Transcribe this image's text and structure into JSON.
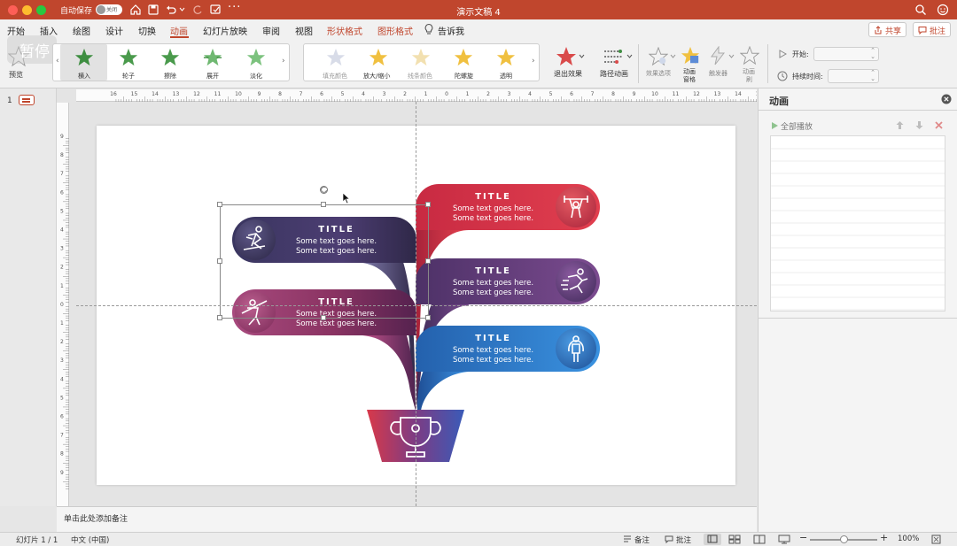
{
  "titlebar": {
    "autosave_label": "自动保存",
    "autosave_toggle": "关闭",
    "doc_title": "演示文稿 4"
  },
  "menu": {
    "items": [
      "开始",
      "插入",
      "绘图",
      "设计",
      "切换",
      "动画",
      "幻灯片放映",
      "审阅",
      "视图",
      "形状格式",
      "图形格式"
    ],
    "tell_me": "告诉我",
    "share": "共享",
    "comments": "批注",
    "active_index": 5
  },
  "ribbon": {
    "preview": "预览",
    "entrance_effects": [
      "横入",
      "轮子",
      "擦除",
      "展开",
      "淡化"
    ],
    "emphasis_effects": [
      "填充颜色",
      "放大/缩小",
      "线条颜色",
      "陀螺旋",
      "透明"
    ],
    "exit_effects": "退出效果",
    "path_animation": "路径动画",
    "effect_options": "效果选项",
    "anim_pane_1": "动画",
    "anim_pane_2": "窗格",
    "trigger": "触发器",
    "anim_painter_1": "动画",
    "anim_painter_2": "刷",
    "start_label": "开始:",
    "duration_label": "持续时间:",
    "pause_watermark": "暂停"
  },
  "thumb": {
    "slide_number": "1"
  },
  "ruler_h": [
    "16",
    "15",
    "14",
    "13",
    "12",
    "11",
    "10",
    "9",
    "8",
    "7",
    "6",
    "5",
    "4",
    "3",
    "2",
    "1",
    "0",
    "1",
    "2",
    "3",
    "4",
    "5",
    "6",
    "7",
    "8",
    "9",
    "10",
    "11",
    "12",
    "13",
    "14",
    "15",
    "16"
  ],
  "ruler_v": [
    "9",
    "8",
    "7",
    "6",
    "5",
    "4",
    "3",
    "2",
    "1",
    "0",
    "1",
    "2",
    "3",
    "4",
    "5",
    "6",
    "7",
    "8",
    "9"
  ],
  "slide": {
    "left_items": [
      {
        "title": "TITLE",
        "line1": "Some text goes here.",
        "line2": "Some text goes here."
      },
      {
        "title": "TITLE",
        "line1": "Some text goes here.",
        "line2": "Some text goes here."
      }
    ],
    "right_items": [
      {
        "title": "TITLE",
        "line1": "Some text goes here.",
        "line2": "Some text goes here."
      },
      {
        "title": "TITLE",
        "line1": "Some text goes here.",
        "line2": "Some text goes here."
      },
      {
        "title": "TITLE",
        "line1": "Some text goes here.",
        "line2": "Some text goes here."
      }
    ]
  },
  "notes": {
    "placeholder": "单击此处添加备注"
  },
  "anim_pane": {
    "title": "动画",
    "play_all": "全部播放"
  },
  "status": {
    "slide_info": "幻灯片 1 / 1",
    "language": "中文 (中国)",
    "notes": "备注",
    "comments": "批注",
    "zoom": "100%",
    "zoom_level": 0.5
  },
  "colors": {
    "accent": "#c0462d",
    "red": "#d8374a",
    "purple": "#5b3a78",
    "blue": "#2a7fd0",
    "navy": "#3b3560",
    "magenta": "#8c2f5e"
  }
}
